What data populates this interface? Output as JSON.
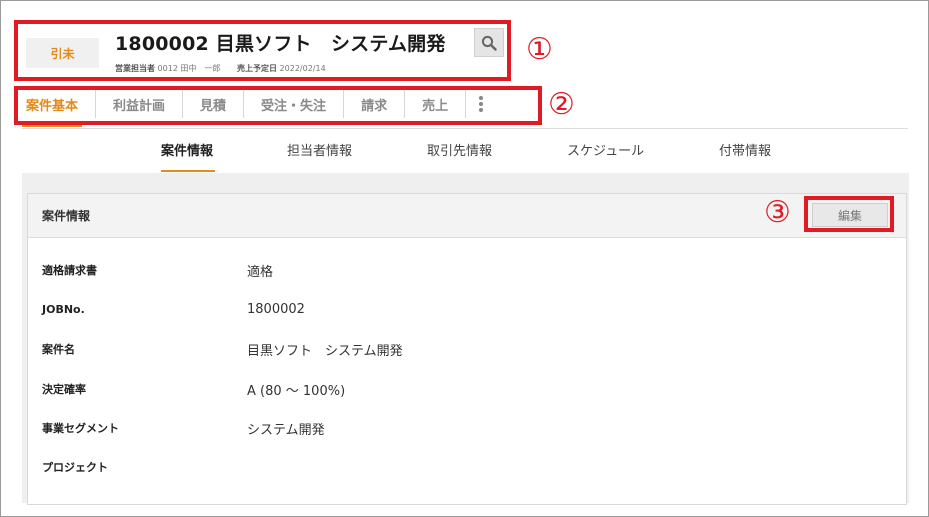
{
  "header": {
    "status": "引未",
    "title": "1800002 目黒ソフト　システム開発",
    "meta": {
      "sales_rep_label": "営業担当者",
      "sales_rep_value": "0012 田中　一郎",
      "sales_date_label": "売上予定日",
      "sales_date_value": "2022/02/14"
    }
  },
  "annotations": {
    "one": "①",
    "two": "②",
    "three": "③"
  },
  "main_tabs": [
    "案件基本",
    "利益計画",
    "見積",
    "受注・失注",
    "請求",
    "売上"
  ],
  "sub_tabs": [
    "案件情報",
    "担当者情報",
    "取引先情報",
    "スケジュール",
    "付帯情報"
  ],
  "panel": {
    "title": "案件情報",
    "edit_label": "編集",
    "fields": [
      {
        "label": "適格請求書",
        "value": "適格"
      },
      {
        "label": "JOBNo.",
        "value": "1800002"
      },
      {
        "label": "案件名",
        "value": "目黒ソフト　システム開発"
      },
      {
        "label": "決定確率",
        "value": "A (80 ～ 100%)"
      },
      {
        "label": "事業セグメント",
        "value": "システム開発"
      },
      {
        "label": "プロジェクト",
        "value": ""
      }
    ]
  },
  "colors": {
    "accent": "#e38a1c",
    "annotation": "#e01b24"
  },
  "icons": {
    "search": "search-icon",
    "more": "more-vertical-icon"
  }
}
